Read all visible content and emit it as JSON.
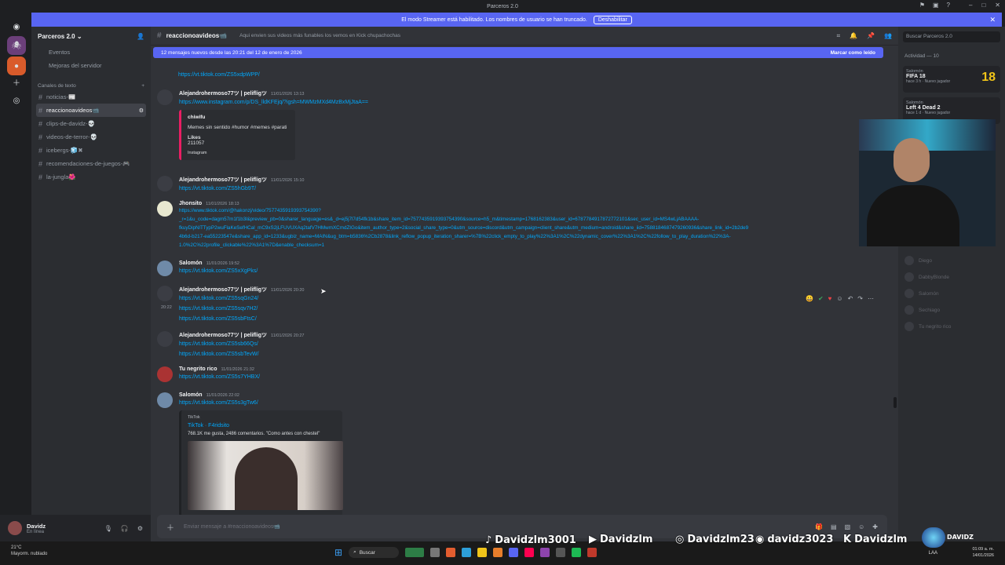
{
  "window": {
    "title": "Parceros 2.0"
  },
  "banner": {
    "text": "El modo Streamer está habilitado. Los nombres de usuario se han truncado.",
    "button": "Deshabilitar"
  },
  "server": {
    "name": "Parceros 2.0 ⌄",
    "items": [
      {
        "label": "Eventos"
      },
      {
        "label": "Mejoras del servidor"
      }
    ]
  },
  "channels": {
    "category": "Canales de texto",
    "list": [
      {
        "label": "noticias-📰"
      },
      {
        "label": "reaccionoavideos📹"
      },
      {
        "label": "clips-de-davidz-💀"
      },
      {
        "label": "videos-de-terror-💀"
      },
      {
        "label": "icebergs-🧊✖"
      },
      {
        "label": "recomendaciones-de-juegos-🎮"
      },
      {
        "label": "la-jungla🌺"
      }
    ]
  },
  "user": {
    "name": "Davidz",
    "status": "En línea"
  },
  "header": {
    "channel": "reaccionoavideos📹",
    "topic": "Aqui envien sus videos más funables los vemos en Kick chupachochas"
  },
  "newbar": {
    "text": "12 mensajes nuevos desde las 20:21 del 12 de enero de 2026",
    "action": "Marcar como leído"
  },
  "messages": {
    "m0": {
      "link": "https://vt.tiktok.com/ZS5xdpWPP/"
    },
    "m1": {
      "author": "Alejandrohermoso77ツ | pelifligツ",
      "time": "11/01/2026 13:13",
      "link": "https://www.instagram.com/p/DS_lldKFEjq/?igsh=MWMzMXd4MzBxMjJtaA==",
      "embed": {
        "account": "chiwifu",
        "desc": "Memes sin sentido #humor #memes #parati",
        "likes_label": "Likes",
        "likes": "211057",
        "source": "Instagram"
      }
    },
    "m2": {
      "author": "Alejandrohermoso77ツ | pelifligツ",
      "time": "11/01/2026 15:10",
      "link": "https://vt.tiktok.com/ZS5hGb9T/"
    },
    "m3": {
      "author": "Jhonsito",
      "time": "11/01/2026 18:13",
      "l1": "https://www.tiktok.com/@hakonzj/video/7577435919393754390?",
      "l2": "_r=1&u_code=dagm57m1f1b3l&preview_pb=0&sharer_language=es&_d=ej5j7l7d54fk1b&share_item_id=7577435919393754390&source=h5_m&timestamp=1768162383&user_id=6787784917872772101&sec_user_id=MS4wLjABAAAA-",
      "l3": "fkuyDipNlTTypP2wuFlaKeSefHCal_mC9xS2jLFUVUXAq2tafV7HMwmXCmdZIGo&item_author_type=2&social_share_type=0&utm_source=discord&utm_campaign=client_share&utm_medium=android&share_iid=7588184687479260936&share_link_id=2b2de9",
      "l4": "4b6d-b217-ea55223547e&share_app_id=1233&ugbiz_name=MAIN&ug_btm=b5836%2Cb2878&link_reflow_popup_iteration_sharer=%7B%22click_empty_to_play%22%3A1%2C%22dynamic_cover%22%3A1%2C%22follow_to_play_duration%22%3A-",
      "l5": "1.0%2C%22profile_clickable%22%3A1%7D&enable_checksum=1"
    },
    "m4": {
      "author": "Salomón",
      "time": "11/01/2026 19:52",
      "link": "https://vt.tiktok.com/ZS5xXgPks/"
    },
    "m5": {
      "author": "Alejandrohermoso77ツ | pelifligツ",
      "time": "11/01/2026 20:20",
      "side_time": "20:22",
      "links": [
        "https://vt.tiktok.com/ZS5sqGn24/",
        "https://vt.tiktok.com/ZS5sqv7H2/",
        "https://vt.tiktok.com/ZS5sbFtsC/"
      ]
    },
    "m6": {
      "author": "Alejandrohermoso77ツ | pelifligツ",
      "time": "11/01/2026 20:27",
      "links": [
        "https://vt.tiktok.com/ZS5sb66Qs/",
        "https://vt.tiktok.com/ZS5sbTevW/"
      ]
    },
    "m7": {
      "author": "Tu negrito rico",
      "time": "11/01/2026 21:32",
      "link": "https://vt.tiktok.com/ZS5s7YHBX/"
    },
    "m8": {
      "author": "Salomón",
      "time": "11/01/2026 22:02",
      "link": "https://vt.tiktok.com/ZS5s3gTw6/",
      "embed": {
        "provider": "TikTok",
        "title": "TikTok · F4ridsito",
        "desc": "768.1K me gusta, 2486 comentarios. \"Como antes con chestel\""
      }
    }
  },
  "composer": {
    "placeholder": "Enviar mensaje a #reaccionoavideos📹"
  },
  "activity": {
    "search": "Buscar Parceros 2.0",
    "label": "Actividad — 10",
    "cards": [
      {
        "who": "Salomón",
        "game": "FIFA 18",
        "meta": "hace 3 h · Nuevo jugador",
        "badge": "18"
      },
      {
        "who": "Salomón",
        "game": "Left 4 Dead 2",
        "meta": "hace 1 d · Nuevo jugador"
      }
    ],
    "members": [
      "Diego",
      "DabbyBlonde",
      "Salomón",
      "Sechiago",
      "Tu negrito rico"
    ]
  },
  "taskbar": {
    "temp": "21°C",
    "weather": "Mayorm. nublado",
    "search": "Buscar",
    "time": "01:09 a. m.",
    "date": "14/01/2026",
    "lang": "LAA"
  },
  "socials": {
    "tiktok": "Davidzlm3001",
    "youtube": "Davidzlm",
    "instagram": "Davidzlm23",
    "discord": "davidz3023",
    "kick": "Davidzlm",
    "brand": "DAVIDZ"
  }
}
